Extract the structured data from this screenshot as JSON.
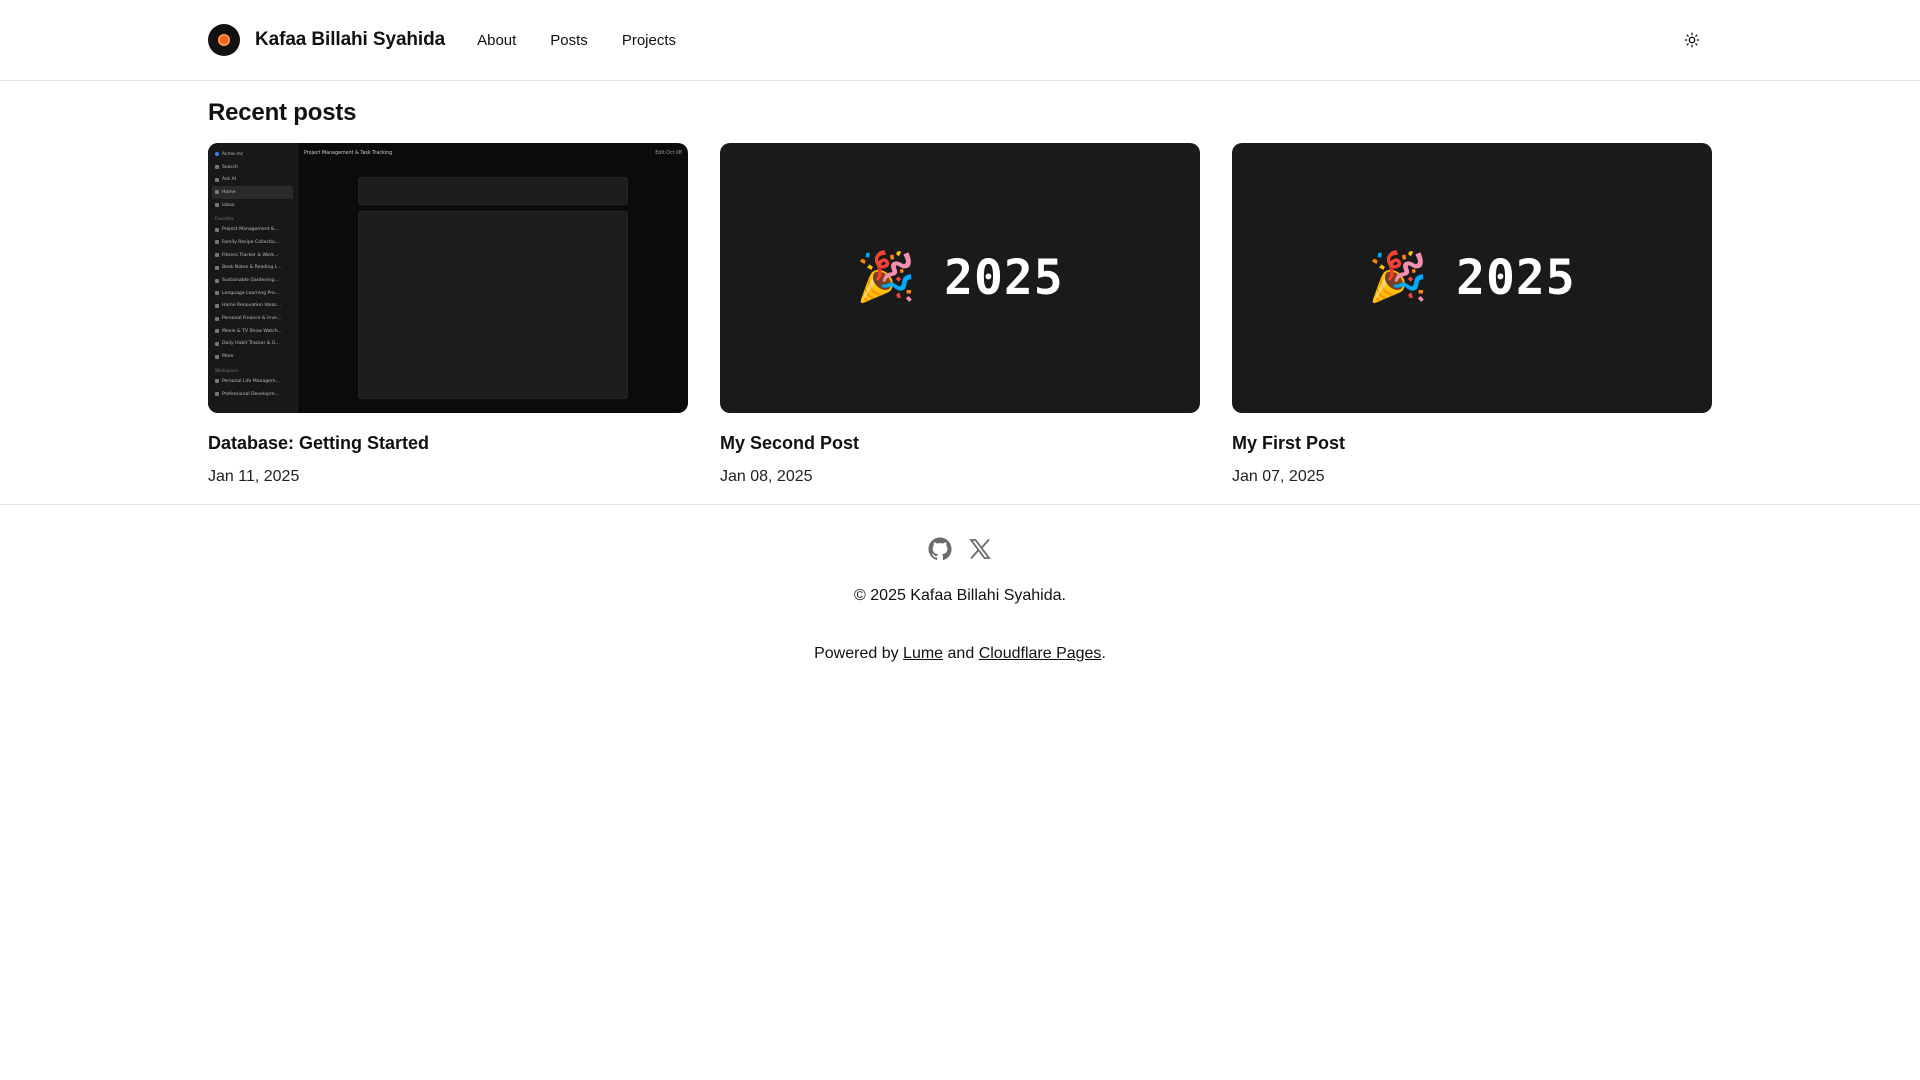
{
  "header": {
    "title": "Kafaa Billahi Syahida",
    "nav": [
      {
        "label": "About"
      },
      {
        "label": "Posts"
      },
      {
        "label": "Projects"
      }
    ]
  },
  "main": {
    "section_title": "Recent posts",
    "posts": [
      {
        "title": "Database: Getting Started",
        "date": "Jan 11, 2025",
        "thumbnail": {
          "type": "screenshot",
          "workspace": "Acme Inc",
          "page_title": "Project Management & Task Tracking",
          "top_right": "Edit Oct 08",
          "sidebar_top": [
            "Search",
            "Ask AI",
            "Home",
            "Inbox"
          ],
          "sidebar_section_favorites": "Favorites",
          "sidebar_favorites": [
            "Project Management &...",
            "Family Recipe Collectio...",
            "Fitness Tracker & Work...",
            "Book Notes & Reading L...",
            "Sustainable Gardening...",
            "Language Learning Pro...",
            "Home Renovation Ideas...",
            "Personal Finance & Inve...",
            "Movie & TV Show Watch...",
            "Daily Habit Tracker & G..."
          ],
          "sidebar_more": "More",
          "sidebar_section_workspace": "Workspace",
          "sidebar_workspace": [
            "Personal Life Managem...",
            "Professional Developm..."
          ]
        }
      },
      {
        "title": "My Second Post",
        "date": "Jan 08, 2025",
        "thumbnail": {
          "type": "emoji",
          "emoji": "🎉",
          "text": "2025"
        }
      },
      {
        "title": "My First Post",
        "date": "Jan 07, 2025",
        "thumbnail": {
          "type": "emoji",
          "emoji": "🎉",
          "text": "2025"
        }
      }
    ]
  },
  "footer": {
    "copyright": "© 2025 Kafaa Billahi Syahida.",
    "powered_prefix": "Powered by",
    "powered_link1": "Lume",
    "powered_and": "and",
    "powered_link2": "Cloudflare Pages",
    "powered_suffix": ".",
    "social_icons": [
      "github-icon",
      "x-icon"
    ]
  },
  "colors": {
    "logo_bg": "#111111",
    "logo_accent": "#f26b1d",
    "thumb_bg": "#1a1a1a",
    "divider": "#e5e5e5"
  }
}
